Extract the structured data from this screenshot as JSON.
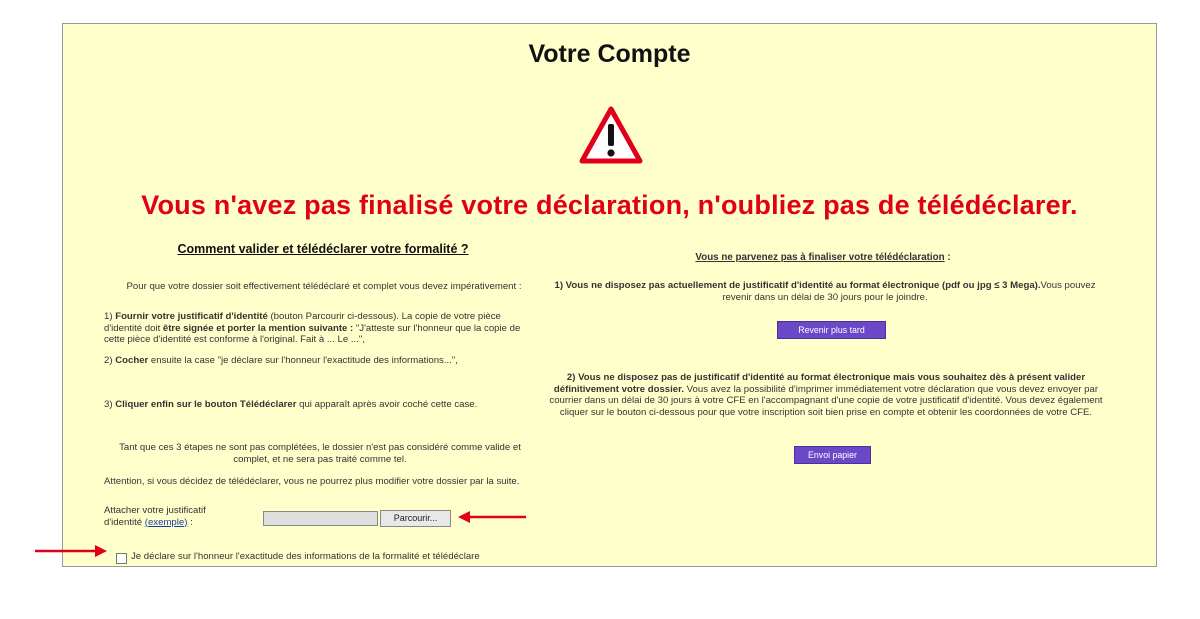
{
  "page": {
    "title": "Votre Compte",
    "headline": "Vous n'avez pas finalisé votre déclaration, n'oubliez pas de télédéclarer."
  },
  "left": {
    "heading": "Comment valider et télédéclarer votre formalité ?",
    "intro": "Pour que votre dossier soit effectivement télédéclaré et complet vous devez impérativement :",
    "step1_num": "1) ",
    "step1_bold": "Fournir votre justificatif d'identité",
    "step1_rest": " (bouton Parcourir ci-dessous). La copie de votre pièce d'identité doit ",
    "step1_bold2": "être signée et porter la mention suivante :",
    "step1_quote": " \"J'atteste sur l'honneur que la copie de cette pièce d'identité est conforme à l'original. Fait à ... Le ...\",",
    "step2_num": "2) ",
    "step2_bold": "Cocher",
    "step2_rest": " ensuite la case \"je déclare sur l'honneur l'exactitude des informations...\",",
    "step3_num": "3) ",
    "step3_bold": "Cliquer enfin sur le bouton Télédéclarer",
    "step3_rest": " qui apparaît après avoir coché cette case.",
    "notice": "Tant que ces 3 étapes ne sont pas complétées, le dossier n'est pas considéré comme valide et complet, et ne sera pas traité comme tel.",
    "warning": "Attention, si vous décidez de télédéclarer, vous ne pourrez plus modifier votre dossier par la suite.",
    "attach_label": "Attacher votre justificatif d'identité",
    "example_link": "(exemple)",
    "attach_colon": " :",
    "browse_label": "Parcourir...",
    "checkbox_label": "Je déclare sur l'honneur l'exactitude des informations de la formalité et télédéclare"
  },
  "right": {
    "heading": "Vous ne parvenez pas à finaliser votre télédéclaration",
    "heading_colon": " :",
    "case1_bold": "1) Vous ne disposez pas actuellement de justificatif d'identité au format électronique (pdf ou jpg ≤ 3 Mega).",
    "case1_rest": "Vous pouvez revenir dans un délai de 30 jours pour le joindre.",
    "button1": "Revenir plus tard",
    "case2_bold": "2) Vous ne disposez pas de justificatif d'identité au format électronique mais vous souhaitez dès à présent valider définitivement votre dossier.",
    "case2_rest": " Vous avez la possibilité d'imprimer immédiatement votre déclaration que vous devez envoyer par courrier dans un délai de 30 jours à votre CFE en l'accompagnant d'une copie de votre justificatif d'identité. Vous devez également cliquer sur le bouton ci-dessous pour que votre inscription soit bien prise en compte et obtenir les coordonnées de votre CFE.",
    "button2": "Envoi papier"
  },
  "colors": {
    "background": "#ffffcc",
    "headline": "#e0001b",
    "button": "#6b48c7",
    "arrow": "#e0001b"
  },
  "icons": [
    "warning-triangle-icon",
    "arrow-right-icon",
    "arrow-left-icon"
  ]
}
